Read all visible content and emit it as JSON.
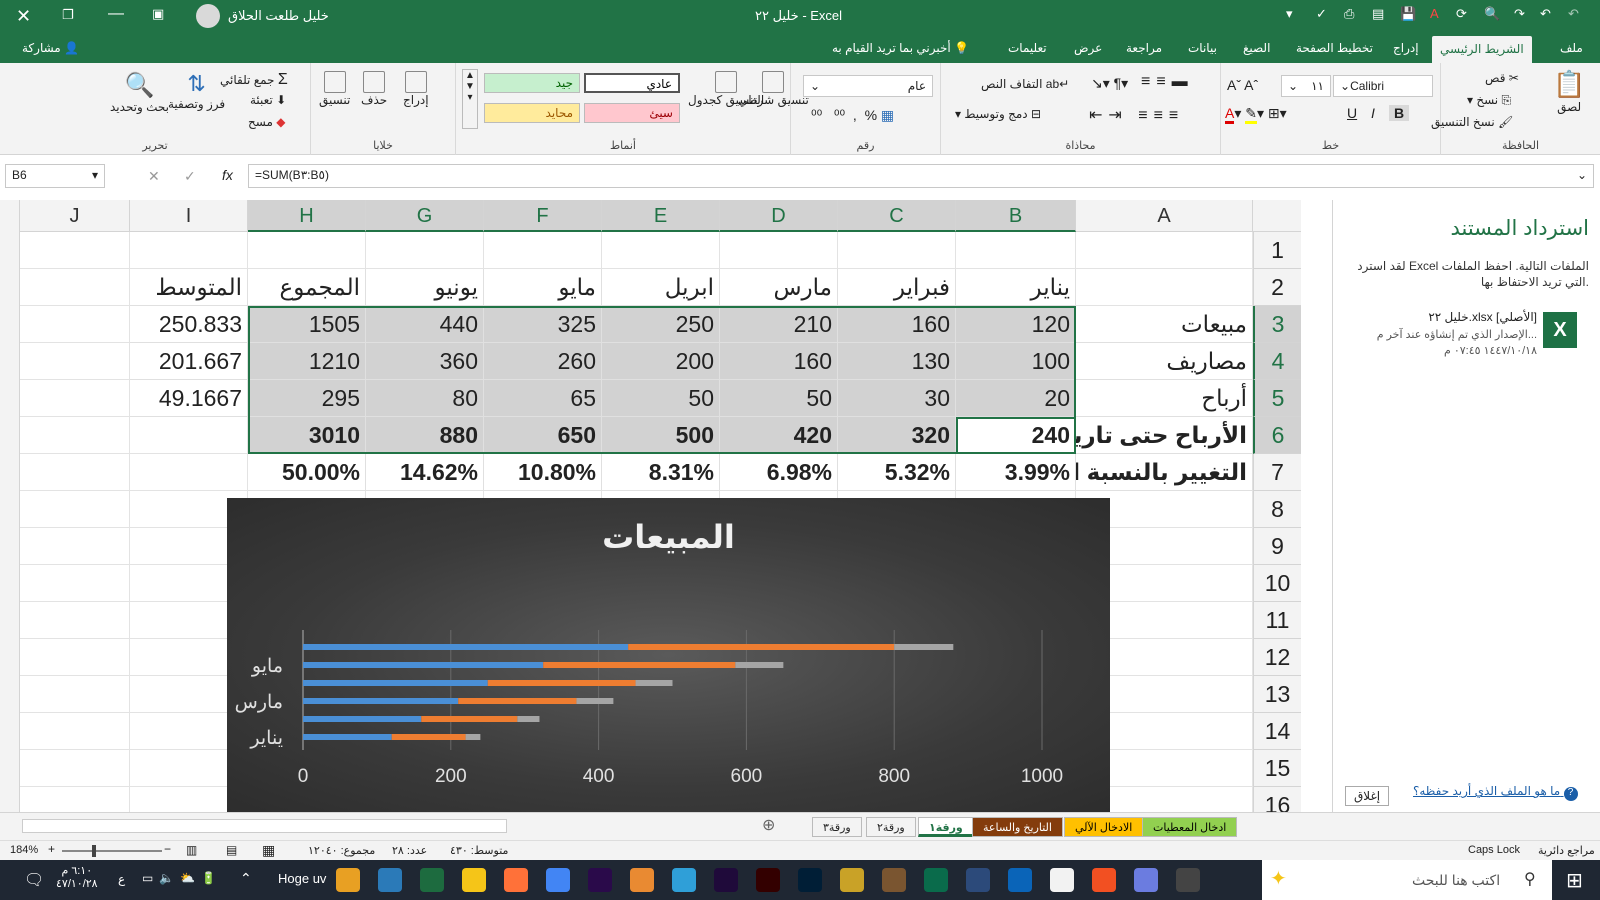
{
  "titlebar": {
    "title": "خليل ٢٢ - Excel",
    "user": "خليل طلعت الحلاق"
  },
  "menu": {
    "items": [
      "ملف",
      "الشريط الرئيسي",
      "إدراج",
      "تخطيط الصفحة",
      "الصيغ",
      "بيانات",
      "مراجعة",
      "عرض",
      "تعليمات"
    ],
    "tell_me": "أخبرني بما تريد القيام به",
    "share": "مشاركة"
  },
  "ribbon": {
    "clipboard": {
      "label": "الحافظة",
      "paste": "لصق",
      "cut": "قص",
      "copy": "نسخ",
      "format_painter": "نسخ التنسيق"
    },
    "font": {
      "label": "خط",
      "font_name": "Calibri",
      "font_size": "١١",
      "bold": "B",
      "italic": "I",
      "underline": "U"
    },
    "alignment": {
      "label": "محاذاة",
      "wrap": "التفاف النص",
      "merge": "دمج وتوسيط"
    },
    "number": {
      "label": "رقم",
      "format": "عام",
      "percent": "%",
      "comma": ","
    },
    "styles": {
      "label": "أنماط",
      "conditional": "تنسيق شرطي",
      "table": "التنسيق كجدول",
      "normal": "عادي",
      "good": "جيد",
      "bad": "سيئ",
      "neutral": "محايد"
    },
    "cells": {
      "label": "خلايا",
      "insert": "إدراج",
      "delete": "حذف",
      "format": "تنسيق"
    },
    "editing": {
      "label": "تحرير",
      "autosum": "جمع تلقائي",
      "fill": "تعبئة",
      "clear": "مسح",
      "sort": "فرز وتصفية",
      "find": "بحث وتحديد"
    }
  },
  "formula": {
    "namebox": "B6",
    "formula": "=SUM(B٣:B٥)",
    "fx": "fx"
  },
  "columns": [
    "J",
    "I",
    "H",
    "G",
    "F",
    "E",
    "D",
    "C",
    "B",
    "A"
  ],
  "rows": [
    "1",
    "2",
    "3",
    "4",
    "5",
    "6",
    "7",
    "8",
    "9",
    "10",
    "11",
    "12",
    "13",
    "14",
    "15",
    "16"
  ],
  "sheet": {
    "headers": [
      "يناير",
      "فبراير",
      "مارس",
      "ابريل",
      "مايو",
      "يونيو",
      "المجموع",
      "المتوسط"
    ],
    "labels": [
      "مبيعات",
      "مصاريف",
      "أرباح",
      "الأرباح حتى تاريخه",
      "التغيير بالنسبة المئوية"
    ],
    "r3": [
      "120",
      "160",
      "210",
      "250",
      "325",
      "440",
      "1505",
      "250.833"
    ],
    "r4": [
      "100",
      "130",
      "160",
      "200",
      "260",
      "360",
      "1210",
      "201.667"
    ],
    "r5": [
      "20",
      "30",
      "50",
      "50",
      "65",
      "80",
      "295",
      "49.1667"
    ],
    "r6": [
      "240",
      "320",
      "420",
      "500",
      "650",
      "880",
      "3010"
    ],
    "r7": [
      "3.99%",
      "5.32%",
      "6.98%",
      "8.31%",
      "10.80%",
      "14.62%",
      "50.00%"
    ]
  },
  "chart_data": {
    "type": "bar",
    "orientation": "horizontal",
    "stacked": true,
    "title": "المبيعات",
    "categories": [
      "يناير",
      "فبراير",
      "مارس",
      "ابريل",
      "مايو",
      "يونيو"
    ],
    "category_labels_shown": [
      "يناير",
      "مارس",
      "مايو"
    ],
    "series": [
      {
        "values": [
          120,
          160,
          210,
          250,
          325,
          440
        ],
        "color": "#4a8fd6"
      },
      {
        "values": [
          100,
          130,
          160,
          200,
          260,
          360
        ],
        "color": "#ee7d31"
      },
      {
        "values": [
          20,
          30,
          50,
          50,
          65,
          80
        ],
        "color": "#a5a5a5"
      }
    ],
    "xlim": [
      0,
      1000
    ],
    "xticks": [
      "0",
      "200",
      "400",
      "600",
      "800",
      "1000"
    ],
    "grid": true
  },
  "pane": {
    "title": "استرداد المستند",
    "desc": "لقد استرد Excel الملفات التالية. احفظ الملفات التي تريد الاحتفاظ بها.",
    "file": "خليل ٢٢.xlsx [الأصلي]",
    "file_desc": "الإصدار الذي تم إنشاؤه عند آخر م...",
    "file_time": "١٤٤٧/١٠/١٨ ٠٧:٤٥ م",
    "help": "ما هو الملف الذي أريد حفظه؟",
    "close": "إغلاق"
  },
  "tabs": [
    "ادخال المعطيات",
    "الادخال الآلي",
    "التاريخ والساعة",
    "ورقة١",
    "ورقة٢",
    "ورقة٣"
  ],
  "status": {
    "zoom": "184%",
    "avg": "متوسط: ٤٣٠",
    "count": "عدد: ٢٨",
    "sum": "مجموع: ١٢٠٤٠",
    "caps": "Caps Lock",
    "circular": "مراجع دائرية"
  },
  "taskbar": {
    "search": "اكتب هنا للبحث",
    "time": "٦:١٠ م",
    "date": "٤٧/١٠/٢٨",
    "lang": "ع",
    "hoge": "Hoge uv"
  }
}
